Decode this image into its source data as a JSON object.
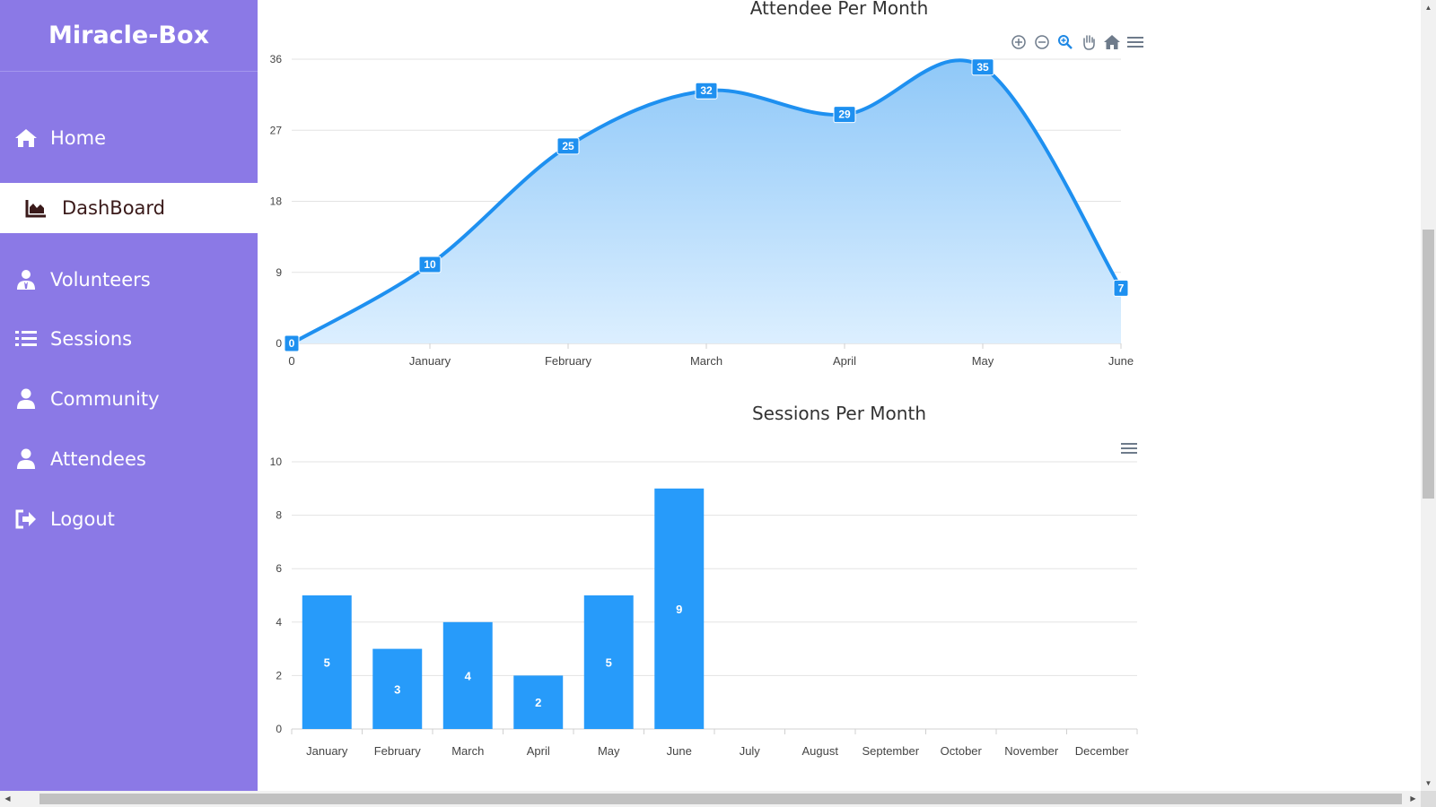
{
  "app": {
    "brand": "Miracle-Box"
  },
  "sidebar": {
    "items": [
      {
        "label": "Home",
        "icon": "home-icon",
        "active": false
      },
      {
        "label": "DashBoard",
        "icon": "chart-area-icon",
        "active": true
      },
      {
        "label": "Volunteers",
        "icon": "user-tie-icon",
        "active": false
      },
      {
        "label": "Sessions",
        "icon": "list-icon",
        "active": false
      },
      {
        "label": "Community",
        "icon": "user-icon",
        "active": false
      },
      {
        "label": "Attendees",
        "icon": "user-icon",
        "active": false
      },
      {
        "label": "Logout",
        "icon": "sign-out-icon",
        "active": false
      }
    ]
  },
  "colors": {
    "sidebar": "#8b79e6",
    "series": "#1e90f0",
    "active_text": "#3a1a1a"
  },
  "chart_data": [
    {
      "type": "area",
      "title": "Attendee Per Month",
      "categories": [
        "0",
        "January",
        "February",
        "March",
        "April",
        "May",
        "June"
      ],
      "values": [
        0,
        10,
        25,
        32,
        29,
        35,
        7
      ],
      "yticks": [
        0,
        9,
        18,
        27,
        36
      ],
      "ylim": [
        0,
        36
      ],
      "grid": true,
      "toolbar": [
        "zoom-in-icon",
        "zoom-out-icon",
        "zoom-select-icon",
        "pan-hand-icon",
        "reset-home-icon",
        "menu-icon"
      ]
    },
    {
      "type": "bar",
      "title": "Sessions Per Month",
      "categories": [
        "January",
        "February",
        "March",
        "April",
        "May",
        "June",
        "July",
        "August",
        "September",
        "October",
        "November",
        "December"
      ],
      "values": [
        5,
        3,
        4,
        2,
        5,
        9,
        null,
        null,
        null,
        null,
        null,
        null
      ],
      "yticks": [
        0,
        2,
        4,
        6,
        8,
        10
      ],
      "ylim": [
        0,
        10
      ],
      "grid": true,
      "toolbar": [
        "menu-icon"
      ]
    }
  ]
}
